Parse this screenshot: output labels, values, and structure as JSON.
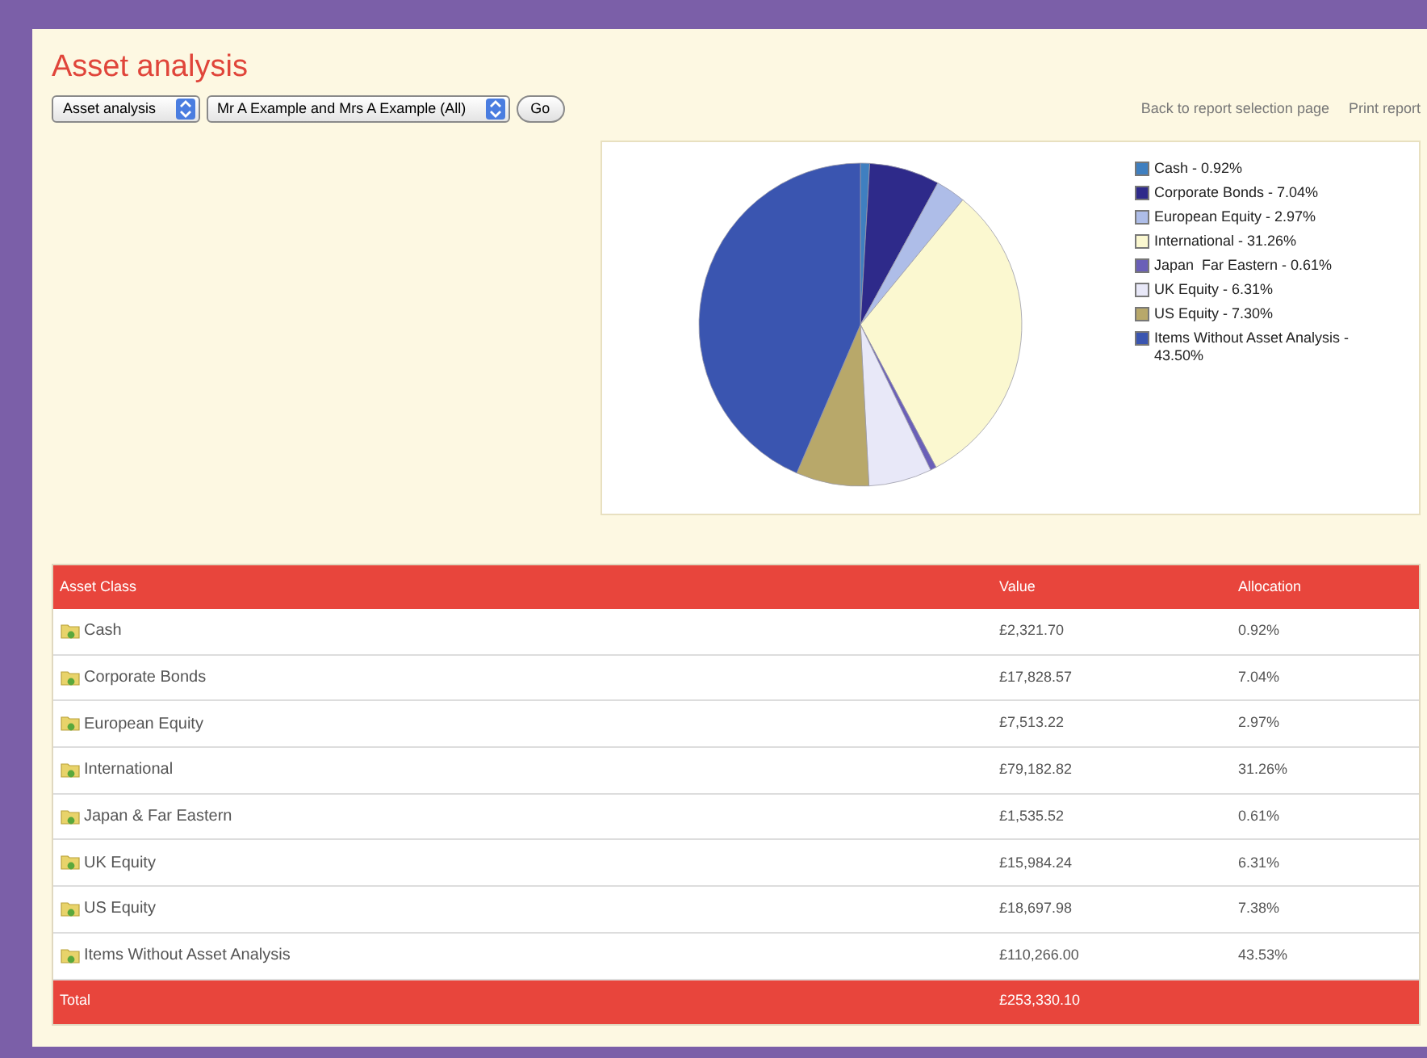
{
  "page": {
    "title": "Asset analysis"
  },
  "controls": {
    "report_select": "Asset analysis",
    "client_select": "Mr A Example and Mrs A Example (All)",
    "go_button": "Go"
  },
  "links": [
    "Back to report selection page",
    "Print report"
  ],
  "chart_data": {
    "type": "pie",
    "categories": [
      "Cash - 0.92%",
      "Corporate Bonds - 7.04%",
      "European Equity - 2.97%",
      "International - 31.26%",
      "Japan  Far Eastern - 0.61%",
      "UK Equity - 6.31%",
      "US Equity - 7.30%",
      "Items Without Asset Analysis - 43.50%"
    ],
    "series": [
      {
        "values": [
          0.92,
          7.04,
          2.97,
          31.26,
          0.61,
          6.31,
          7.3,
          43.5
        ]
      }
    ],
    "colors": [
      "#3f7fc0",
      "#2e2a8a",
      "#aebde8",
      "#fbf8d0",
      "#6a5fb8",
      "#e8e8f8",
      "#b8a86a",
      "#3a55b0"
    ]
  },
  "table": {
    "columns": [
      "Asset Class",
      "Value",
      "Allocation"
    ],
    "rows": [
      {
        "asset_class": "Cash",
        "value": "£2,321.70",
        "allocation": "0.92%"
      },
      {
        "asset_class": "Corporate Bonds",
        "value": "£17,828.57",
        "allocation": "7.04%"
      },
      {
        "asset_class": "European Equity",
        "value": "£7,513.22",
        "allocation": "2.97%"
      },
      {
        "asset_class": "International",
        "value": "£79,182.82",
        "allocation": "31.26%"
      },
      {
        "asset_class": "Japan & Far Eastern",
        "value": "£1,535.52",
        "allocation": "0.61%"
      },
      {
        "asset_class": "UK Equity",
        "value": "£15,984.24",
        "allocation": "6.31%"
      },
      {
        "asset_class": "US Equity",
        "value": "£18,697.98",
        "allocation": "7.38%"
      },
      {
        "asset_class": "Items Without Asset Analysis",
        "value": "£110,266.00",
        "allocation": "43.53%"
      }
    ],
    "total": {
      "label": "Total",
      "value": "£253,330.10"
    }
  }
}
